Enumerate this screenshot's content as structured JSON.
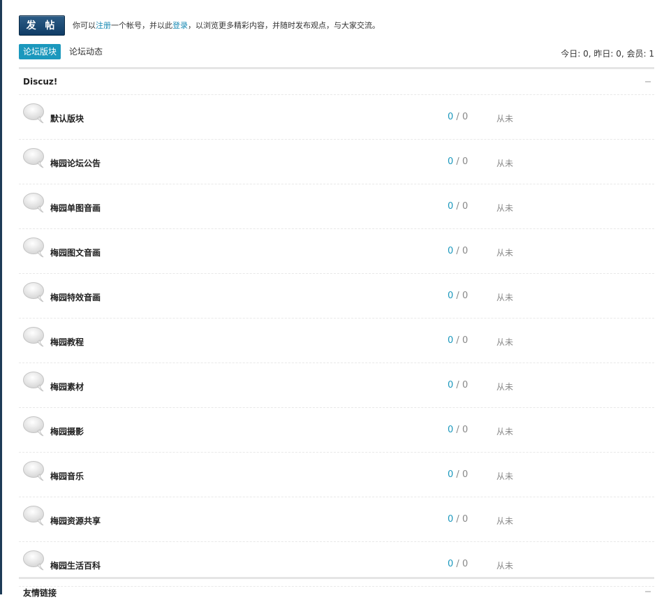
{
  "header": {
    "post_button": "发 帖",
    "welcome_prefix": "你可以",
    "register_link": "注册",
    "welcome_mid": "一个帐号，并以此",
    "login_link": "登录",
    "welcome_suffix": "，以浏览更多精彩内容，并随时发布观点，与大家交流。"
  },
  "tabs": [
    {
      "label": "论坛版块",
      "active": true
    },
    {
      "label": "论坛动态",
      "active": false
    }
  ],
  "stats": "今日: 0, 昨日: 0, 会员: 1",
  "category": {
    "title": "Discuz!",
    "forums": [
      {
        "name": "默认版块",
        "threads": "0",
        "posts": "0",
        "lastpost": "从未"
      },
      {
        "name": "梅园论坛公告",
        "threads": "0",
        "posts": "0",
        "lastpost": "从未"
      },
      {
        "name": "梅园单图音画",
        "threads": "0",
        "posts": "0",
        "lastpost": "从未"
      },
      {
        "name": "梅园图文音画",
        "threads": "0",
        "posts": "0",
        "lastpost": "从未"
      },
      {
        "name": "梅园特效音画",
        "threads": "0",
        "posts": "0",
        "lastpost": "从未"
      },
      {
        "name": "梅园教程",
        "threads": "0",
        "posts": "0",
        "lastpost": "从未"
      },
      {
        "name": "梅园素材",
        "threads": "0",
        "posts": "0",
        "lastpost": "从未"
      },
      {
        "name": "梅园摄影",
        "threads": "0",
        "posts": "0",
        "lastpost": "从未"
      },
      {
        "name": "梅园音乐",
        "threads": "0",
        "posts": "0",
        "lastpost": "从未"
      },
      {
        "name": "梅园资源共享",
        "threads": "0",
        "posts": "0",
        "lastpost": "从未"
      },
      {
        "name": "梅园生活百科",
        "threads": "0",
        "posts": "0",
        "lastpost": "从未"
      }
    ]
  },
  "links_category": {
    "title": "友情链接"
  },
  "colors": {
    "accent": "#1b98bd",
    "button": "#0f3c66"
  }
}
